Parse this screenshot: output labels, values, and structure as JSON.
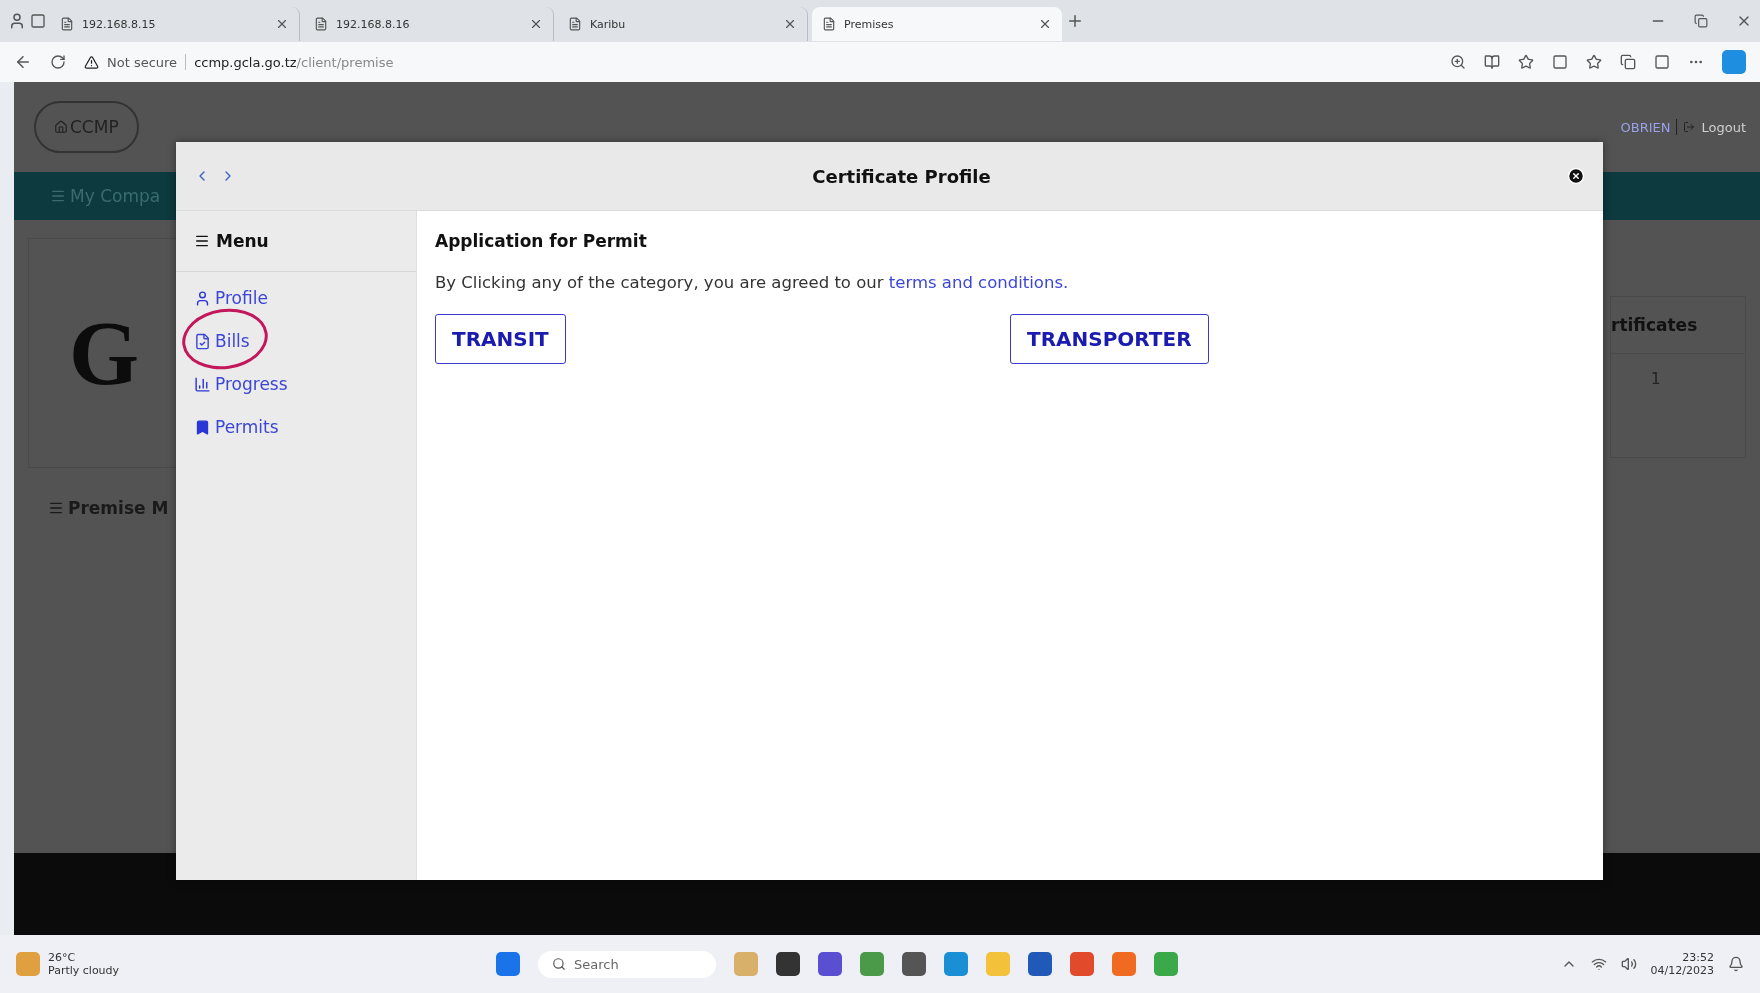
{
  "browser": {
    "tabs": [
      {
        "title": "192.168.8.15",
        "selected": false
      },
      {
        "title": "192.168.8.16",
        "selected": false
      },
      {
        "title": "Karibu",
        "selected": false
      },
      {
        "title": "Premises",
        "selected": true
      }
    ],
    "address": {
      "warning": "Not secure",
      "host": "ccmp.gcla.go.tz",
      "path": "/client/premise"
    }
  },
  "page": {
    "brand": "CCMP",
    "user": "OBRIEN",
    "logout": "Logout",
    "nav_item": "My Compa",
    "logo_text": "G",
    "section_title": "Premise M",
    "table_heading": "rtificates",
    "table_cell": "1"
  },
  "modal": {
    "title": "Certificate Profile",
    "menu_title": "Menu",
    "menu": [
      {
        "label": "Profile",
        "kind": "profile",
        "circled": false
      },
      {
        "label": "Bills",
        "kind": "bills",
        "circled": true
      },
      {
        "label": "Progress",
        "kind": "progress",
        "circled": false
      },
      {
        "label": "Permits",
        "kind": "permits",
        "circled": false
      }
    ],
    "heading": "Application for Permit",
    "text": "By Clicking any of the category, you are agreed to our ",
    "link": "terms and conditions.",
    "buttons": [
      "TRANSIT",
      "TRANSPORTER"
    ]
  },
  "taskbar": {
    "temperature": "26°C",
    "weather": "Partly cloudy",
    "search": "Search",
    "time": "23:52",
    "date": "04/12/2023"
  }
}
